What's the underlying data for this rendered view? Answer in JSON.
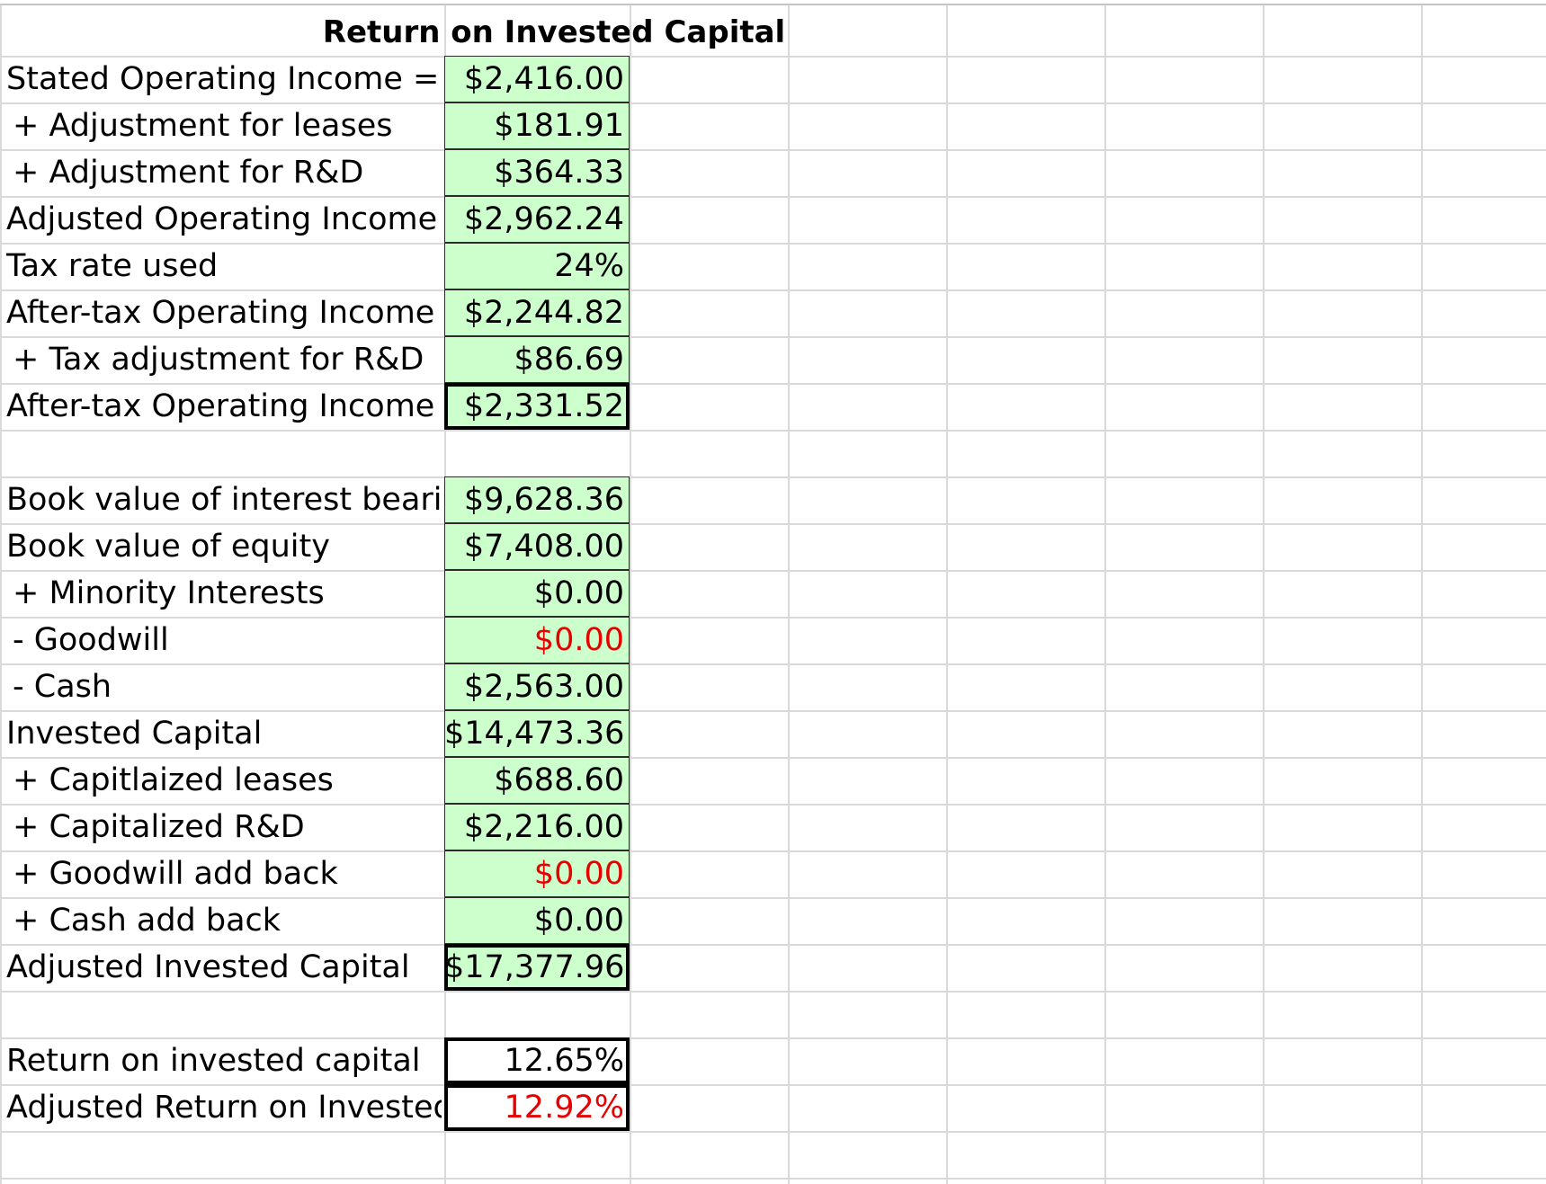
{
  "title": "Return on Invested Capital",
  "rows": [
    {
      "label": "Stated Operating Income =",
      "value": "$2,416.00"
    },
    {
      "label": "+ Adjustment for leases",
      "value": "$181.91"
    },
    {
      "label": "+ Adjustment for R&D",
      "value": "$364.33"
    },
    {
      "label": "Adjusted Operating Income",
      "value": "$2,962.24"
    },
    {
      "label": "Tax rate used",
      "value": "24%"
    },
    {
      "label": "After-tax Operating Income",
      "value": "$2,244.82"
    },
    {
      "label": "+ Tax adjustment for R&D",
      "value": "$86.69"
    },
    {
      "label": "After-tax Operating Income",
      "value": "$2,331.52"
    },
    {
      "label": "",
      "value": ""
    },
    {
      "label": "Book value of interest bearing",
      "value": "$9,628.36"
    },
    {
      "label": "Book value of equity",
      "value": "$7,408.00"
    },
    {
      "label": "+ Minority Interests",
      "value": "$0.00"
    },
    {
      "label": "- Goodwill",
      "value": "$0.00"
    },
    {
      "label": "- Cash",
      "value": "$2,563.00"
    },
    {
      "label": "Invested Capital",
      "value": "$14,473.36"
    },
    {
      "label": "+ Capitlaized leases",
      "value": "$688.60"
    },
    {
      "label": "+ Capitalized R&D",
      "value": "$2,216.00"
    },
    {
      "label": "+ Goodwill add back",
      "value": "$0.00"
    },
    {
      "label": "+ Cash add back",
      "value": "$0.00"
    },
    {
      "label": "Adjusted Invested Capital",
      "value": "$17,377.96"
    },
    {
      "label": "",
      "value": ""
    },
    {
      "label": "Return on invested capital",
      "value": "12.65%"
    },
    {
      "label": "Adjusted Return on Invested Ca",
      "value": "12.92%"
    }
  ],
  "colors": {
    "cell_fill": "#ccffcc",
    "negative_red": "#e60000",
    "gridline": "#d9d9d9"
  }
}
